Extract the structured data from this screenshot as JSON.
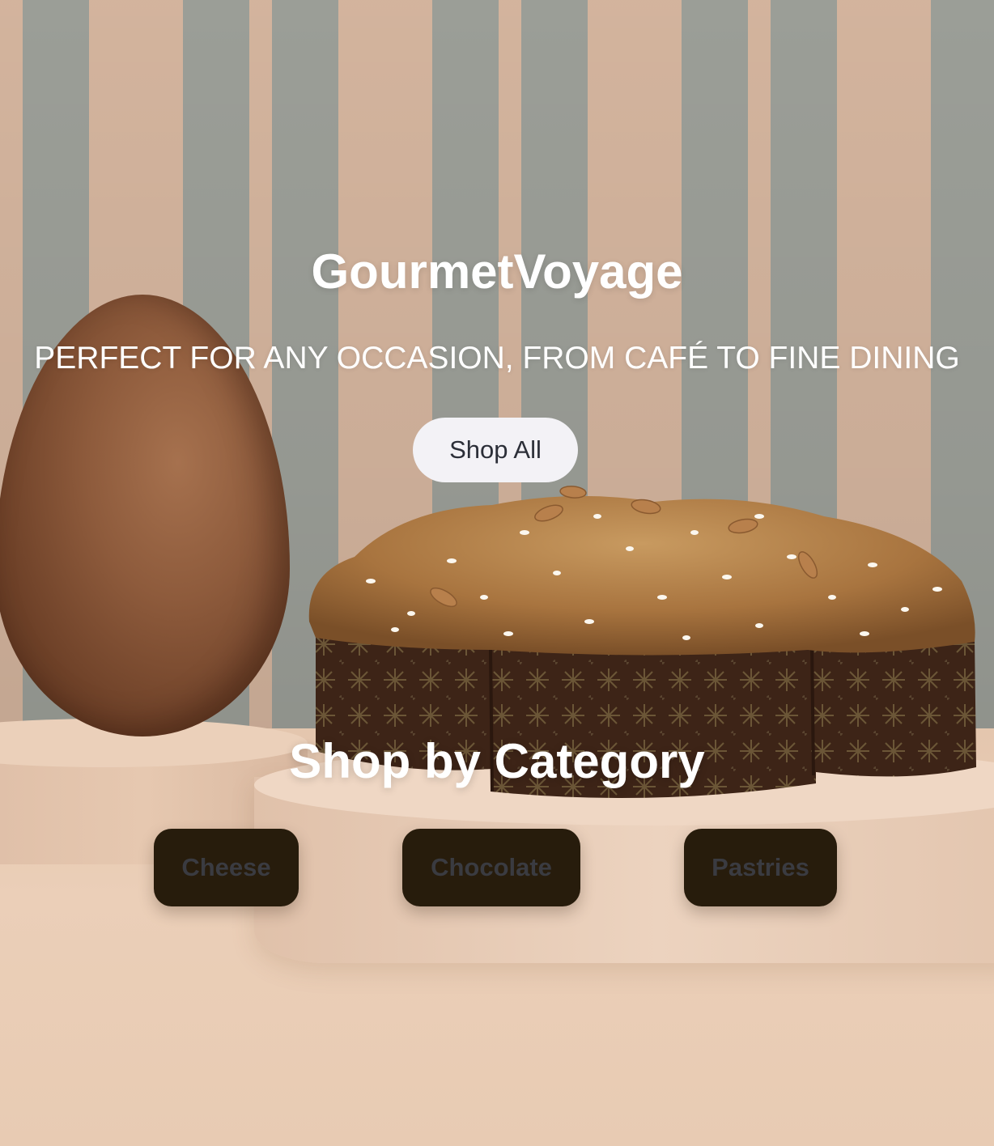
{
  "hero": {
    "brand": "GourmetVoyage",
    "tagline": "PERFECT FOR ANY OCCASION, FROM CAFÉ TO FINE DINING",
    "shop_all_label": "Shop All"
  },
  "categories": {
    "heading": "Shop by Category",
    "items": [
      {
        "label": "Cheese"
      },
      {
        "label": "Chocolate"
      },
      {
        "label": "Pastries"
      }
    ]
  },
  "colors": {
    "button_light": "#f3f2f6",
    "category_button": "#271c0c",
    "stripe_sage": "#9ea19a",
    "stripe_peach": "#d7b7a0"
  }
}
